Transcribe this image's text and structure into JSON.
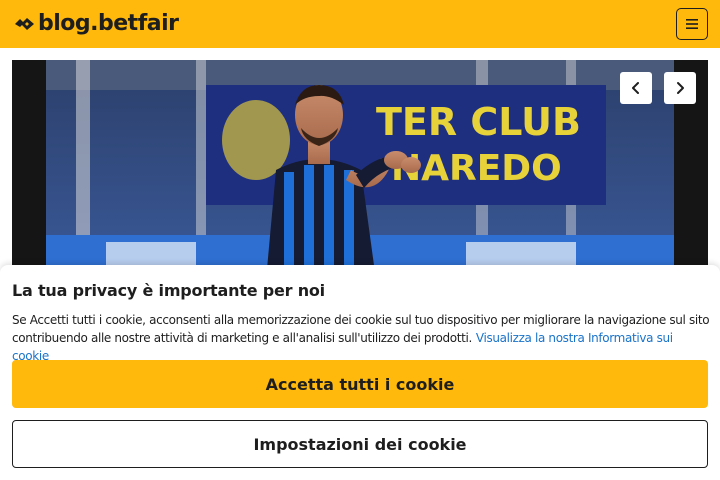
{
  "header": {
    "logo_text": "blog.betfair",
    "logo_icon": "betfair-arrows-icon",
    "menu_icon": "hamburger-menu-icon",
    "background_color": "#ffb80c"
  },
  "hero": {
    "image": "photo of football player in blue and black striped kit applauding in a stadium",
    "prev_icon": "chevron-left-icon",
    "next_icon": "chevron-right-icon"
  },
  "cookie_banner": {
    "title": "La tua privacy è importante per noi",
    "text": "Se Accetti tutti i cookie, acconsenti alla memorizzazione dei cookie sul tuo dispositivo per migliorare la navigazione sul sito contribuendo alle nostre attività di marketing e all'analisi sull'utilizzo dei prodotti.",
    "link_text": "Visualizza la nostra Informativa sui cookie",
    "accept_label": "Accetta tutti i cookie",
    "settings_label": "Impostazioni dei cookie",
    "link_color": "#1a73c9",
    "accent_color": "#ffb80c"
  }
}
